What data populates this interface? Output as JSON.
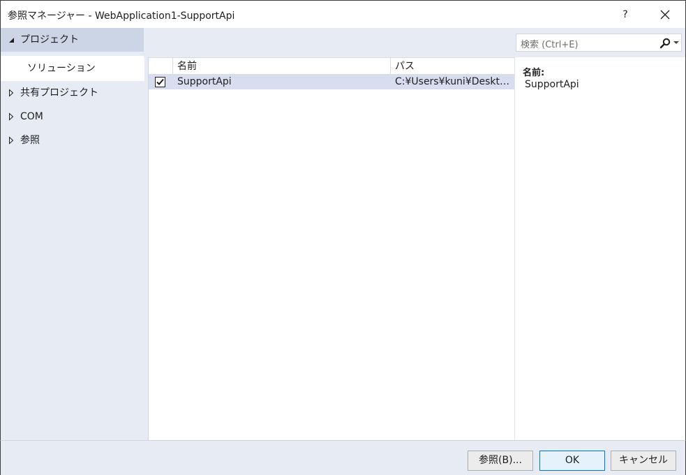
{
  "window": {
    "title": "参照マネージャー - WebApplication1-SupportApi",
    "help_label": "?"
  },
  "sidebar": {
    "items": [
      {
        "label": "プロジェクト",
        "state": "expanded"
      },
      {
        "label": "ソリューション",
        "state": "selected"
      },
      {
        "label": "共有プロジェクト",
        "state": "collapsed"
      },
      {
        "label": "COM",
        "state": "collapsed"
      },
      {
        "label": "参照",
        "state": "collapsed"
      }
    ]
  },
  "search": {
    "placeholder": "検索 (Ctrl+E)"
  },
  "table": {
    "columns": [
      "名前",
      "パス"
    ],
    "rows": [
      {
        "checked": true,
        "name": "SupportApi",
        "path": "C:¥Users¥kuni¥Deskto..."
      }
    ]
  },
  "details": {
    "label": "名前:",
    "value": "SupportApi"
  },
  "footer": {
    "browse_label": "参照(B)...",
    "ok_label": "OK",
    "cancel_label": "キャンセル"
  },
  "colors": {
    "sidebar_bg": "#e6ebf4",
    "selected_row": "#d8deef",
    "ok_border": "#0078d7"
  }
}
